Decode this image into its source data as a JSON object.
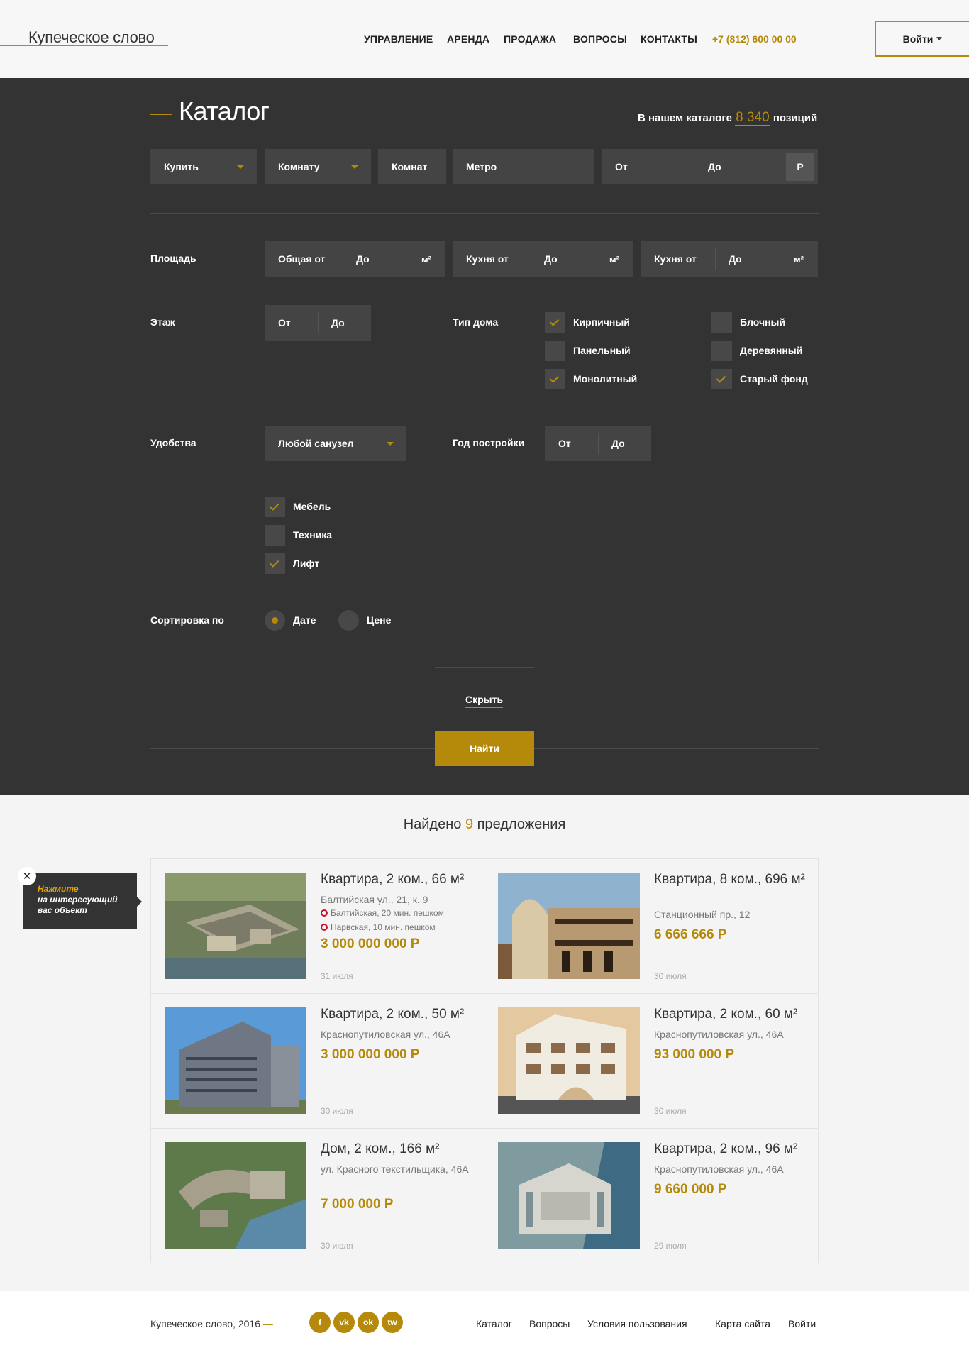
{
  "brand": {
    "name": "Купеческое слово"
  },
  "nav": {
    "items": [
      "УПРАВЛЕНИЕ",
      "АРЕНДА",
      "ПРОДАЖА",
      "ВОПРОСЫ",
      "КОНТАКТЫ"
    ],
    "phone": "+7 (812) 600 00 00",
    "login": "Войти"
  },
  "catalog": {
    "title": "Каталог",
    "count_prefix": "В нашем каталоге",
    "count": "8 340",
    "count_suffix": "позиций"
  },
  "search": {
    "deal": "Купить",
    "object": "Комнату",
    "rooms": "Комнат",
    "metro": "Метро",
    "price_from": "От",
    "price_to": "До",
    "currency": "Р"
  },
  "area": {
    "label": "Площадь",
    "total_from": "Общая от",
    "total_to": "До",
    "kitchen1_from": "Кухня от",
    "kitchen1_to": "До",
    "kitchen2_from": "Кухня от",
    "kitchen2_to": "До",
    "unit": "м²"
  },
  "floor": {
    "label": "Этаж",
    "from": "От",
    "to": "До"
  },
  "house_type": {
    "label": "Тип дома",
    "options": [
      {
        "label": "Кирпичный",
        "checked": true
      },
      {
        "label": "Блочный",
        "checked": false
      },
      {
        "label": "Панельный",
        "checked": false
      },
      {
        "label": "Деревянный",
        "checked": false
      },
      {
        "label": "Монолитный",
        "checked": true
      },
      {
        "label": "Старый фонд",
        "checked": true
      }
    ]
  },
  "amenities": {
    "label": "Удобства",
    "bathroom": "Любой санузел",
    "options": [
      {
        "label": "Мебель",
        "checked": true
      },
      {
        "label": "Техника",
        "checked": false
      },
      {
        "label": "Лифт",
        "checked": true
      }
    ]
  },
  "year": {
    "label": "Год постройки",
    "from": "От",
    "to": "До"
  },
  "sort": {
    "label": "Сортировка по",
    "options": [
      {
        "label": "Дате",
        "selected": true
      },
      {
        "label": "Цене",
        "selected": false
      }
    ]
  },
  "actions": {
    "hide": "Скрыть",
    "find": "Найти"
  },
  "results": {
    "found_prefix": "Найдено",
    "found_count": "9",
    "found_suffix": "предложения",
    "items": [
      {
        "title": "Квартира, 2 ком., 66 м²",
        "address": "Балтийская ул., 21, к. 9",
        "metro": [
          "Балтийская, 20 мин. пешком",
          "Нарвская, 10 мин. пешком"
        ],
        "price": "3 000 000 000 Р",
        "date": "31 июля"
      },
      {
        "title": "Квартира, 8 ком., 696 м²",
        "address": "Станционный пр., 12",
        "price": "6 666 666 Р",
        "date": "30 июля"
      },
      {
        "title": "Квартира, 2 ком., 50 м²",
        "address": "Краснопутиловская ул., 46А",
        "price": "3 000 000 000 Р",
        "date": "30 июля"
      },
      {
        "title": "Квартира, 2 ком., 60 м²",
        "address": "Краснопутиловская ул., 46А",
        "price": "93 000 000 Р",
        "date": "30 июля"
      },
      {
        "title": "Дом, 2 ком., 166 м²",
        "address": "ул. Красного текстильщика, 46А",
        "price": "7 000 000 Р",
        "date": "30 июля"
      },
      {
        "title": "Квартира, 2 ком., 96 м²",
        "address": "Краснопутиловская ул., 46А",
        "price": "9 660 000 Р",
        "date": "29 июля"
      }
    ]
  },
  "tooltip": {
    "highlight": "Нажмите",
    "text1": "на интересующий",
    "text2": "вас объект",
    "close": "✕"
  },
  "footer": {
    "copyright": "Купеческое слово, 2016",
    "dash": "—",
    "social": [
      "f",
      "vk",
      "ok",
      "tw"
    ],
    "links": [
      "Каталог",
      "Вопросы",
      "Условия пользования",
      "Карта сайта",
      "Войти"
    ]
  },
  "colors": {
    "accent": "#b5890a",
    "dark": "#333333",
    "field": "#444444"
  }
}
